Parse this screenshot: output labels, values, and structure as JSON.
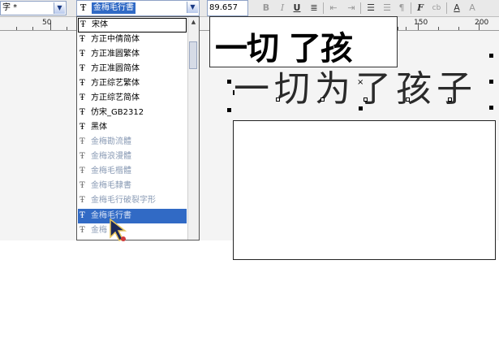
{
  "toolbar": {
    "paragraph_style": "字 *",
    "font_name": "金梅毛行書",
    "font_size": "89.657",
    "bold": "B",
    "italic": "I",
    "underline": "U",
    "paragraph_mark": "¶",
    "format_btn": "F",
    "subscript_btn": "cb"
  },
  "ruler": {
    "labels": [
      "50",
      "150",
      "200"
    ]
  },
  "font_list": {
    "items": [
      {
        "label": "宋体",
        "dim": false
      },
      {
        "label": "方正中倩简体",
        "dim": false
      },
      {
        "label": "方正准圆繁体",
        "dim": false
      },
      {
        "label": "方正准圆简体",
        "dim": false
      },
      {
        "label": "方正综艺繁体",
        "dim": false
      },
      {
        "label": "方正综艺简体",
        "dim": false
      },
      {
        "label": "仿宋_GB2312",
        "dim": false
      },
      {
        "label": "黑体",
        "dim": false
      },
      {
        "label": "金梅勘流體",
        "dim": true
      },
      {
        "label": "金梅浪漫體",
        "dim": true
      },
      {
        "label": "金梅毛楷體",
        "dim": true
      },
      {
        "label": "金梅毛隸書",
        "dim": true
      },
      {
        "label": "金梅毛行破裂字形",
        "dim": true
      },
      {
        "label": "金梅毛行書",
        "dim": true
      },
      {
        "label": "金梅",
        "dim": true
      }
    ]
  },
  "preview": {
    "text": "一切 了孩"
  },
  "canvas": {
    "text": "一切为了孩子"
  }
}
